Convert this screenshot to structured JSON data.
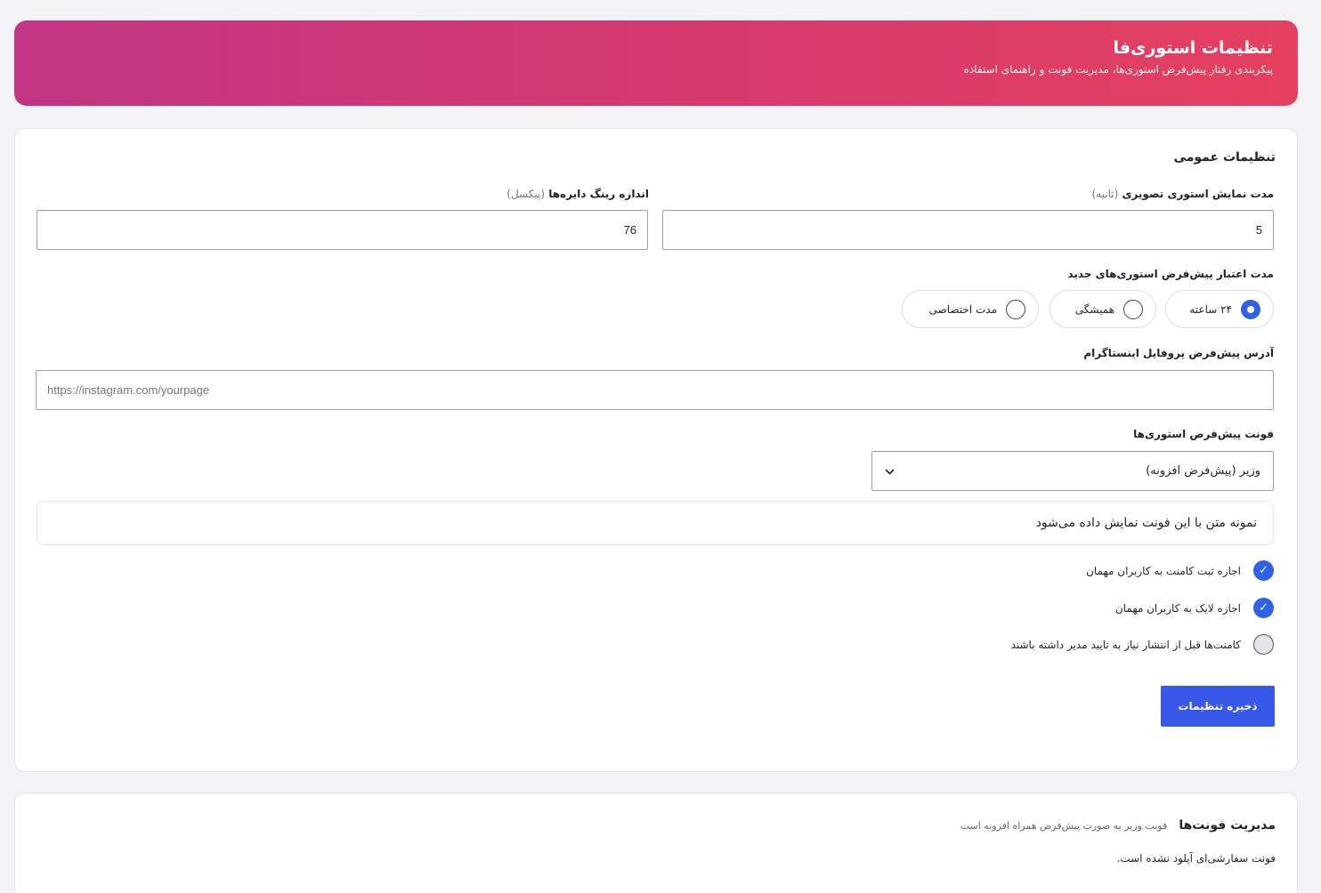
{
  "header": {
    "title": "تنظیمات استوری‌فا",
    "subtitle": "پیکربندی رفتار پیش‌فرض استوری‌ها، مدیریت فونت و راهنمای استفاده"
  },
  "general": {
    "title": "تنظیمات عمومی",
    "duration_label": "مدت نمایش استوری تصویری",
    "duration_hint": "(ثانیه)",
    "duration_value": "5",
    "ring_label": "اندازه رینگ دایره‌ها",
    "ring_hint": "(پیکسل)",
    "ring_value": "76",
    "validity_label": "مدت اعتبار پیش‌فرض استوری‌های جدید",
    "validity_options": [
      {
        "label": "۲۴ ساعته",
        "selected": true
      },
      {
        "label": "همیشگی",
        "selected": false
      },
      {
        "label": "مدت اختصاصی",
        "selected": false
      }
    ],
    "instagram_label": "آدرس پیش‌فرض پروفایل اینستاگرام",
    "instagram_placeholder": "https://instagram.com/yourpage",
    "font_label": "فونت پیش‌فرض استوری‌ها",
    "font_selected": "وزیر (پیش‌فرض افزونه)",
    "font_preview": "نمونه متن با این فونت نمایش داده می‌شود",
    "checks": [
      {
        "label": "اجازه ثبت کامنت به کاربران مهمان",
        "checked": true
      },
      {
        "label": "اجازه لایک به کاربران مهمان",
        "checked": true
      },
      {
        "label": "کامنت‌ها قبل از انتشار نیاز به تایید مدیر داشته باشند",
        "checked": false
      }
    ],
    "save_label": "ذخیره تنظیمات"
  },
  "fonts": {
    "title": "مدیریت فونت‌ها",
    "subtitle": "فونت وزیر به صورت پیش‌فرض همراه افزونه است",
    "empty_note": "فونت سفارشی‌ای آپلود نشده است."
  },
  "icons": {
    "chevron": "chevron-down-icon",
    "check": "check-icon"
  },
  "colors": {
    "accent": "#3858e9",
    "header_start": "#e4405f",
    "header_end": "#c13584"
  }
}
